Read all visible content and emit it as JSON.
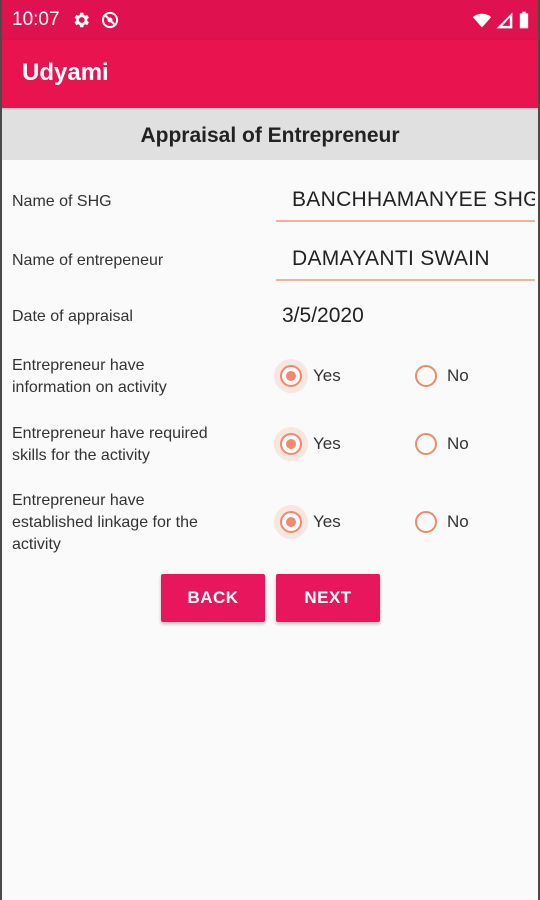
{
  "status_bar": {
    "time": "10:07",
    "icons": [
      "gear-icon",
      "sync-off-icon",
      "wifi-icon",
      "signal-icon",
      "battery-icon"
    ]
  },
  "app_bar": {
    "title": "Udyami"
  },
  "section": {
    "title": "Appraisal of Entrepreneur"
  },
  "form": {
    "shg_name": {
      "label": "Name of SHG",
      "value": "BANCHHAMANYEE SHG"
    },
    "entrepreneur_name": {
      "label": "Name of entrepeneur",
      "value": "DAMAYANTI SWAIN"
    },
    "appraisal_date": {
      "label": "Date of appraisal",
      "value": "3/5/2020"
    },
    "questions": [
      {
        "label_lines": [
          "Entrepreneur have",
          "information on activity"
        ],
        "selected": "Yes"
      },
      {
        "label_lines": [
          "Entrepreneur have required",
          "skills for the activity"
        ],
        "selected": "Yes"
      },
      {
        "label_lines": [
          "Entrepreneur have",
          "established linkage for the",
          "activity"
        ],
        "selected": "Yes"
      }
    ],
    "option_yes": "Yes",
    "option_no": "No"
  },
  "buttons": {
    "back": "BACK",
    "next": "NEXT"
  },
  "colors": {
    "primary": "#e8134f",
    "status_bar": "#e0114f",
    "accent": "#f08a6a",
    "button": "#e8175d",
    "header_bg": "#e0e0e0"
  }
}
